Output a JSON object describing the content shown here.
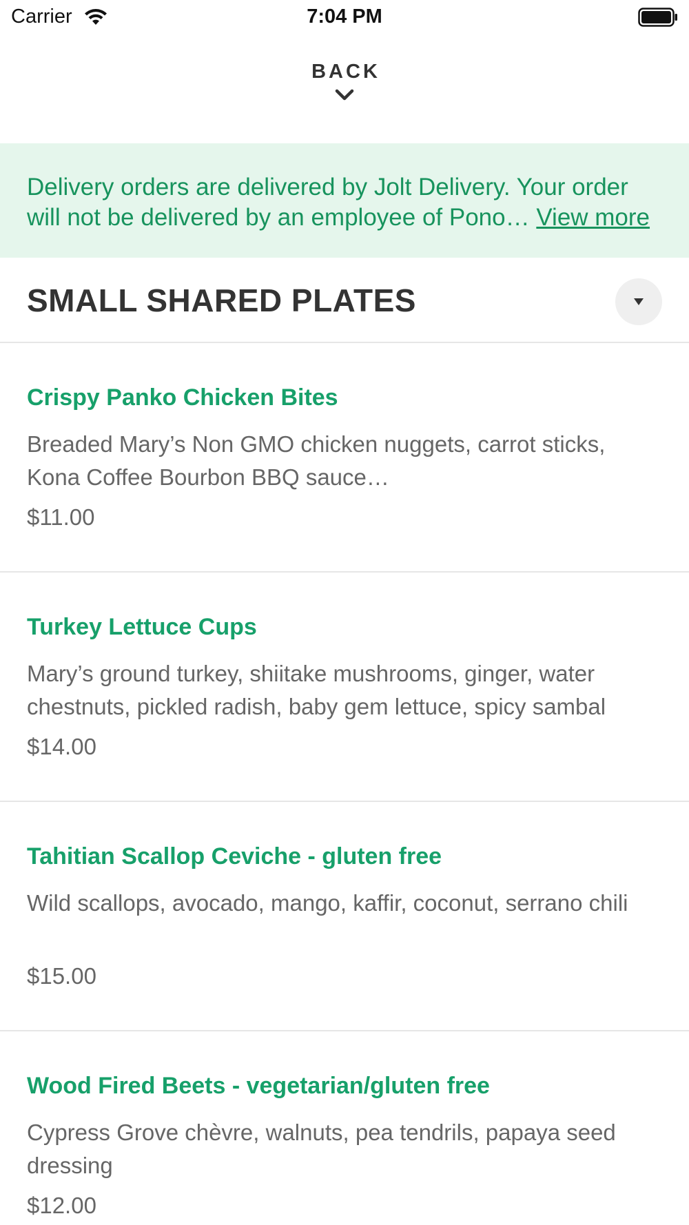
{
  "status_bar": {
    "carrier": "Carrier",
    "time": "7:04 PM",
    "wifi_icon": "wifi-icon",
    "battery_icon": "battery-icon"
  },
  "header": {
    "back_label": "BACK",
    "back_icon": "chevron-down-icon"
  },
  "banner": {
    "text": "Delivery orders are delivered by Jolt Delivery. Your order will not be delivered by an employee of Pono… ",
    "link_label": "View more",
    "background_color": "#e5f6ec",
    "text_color": "#17935d"
  },
  "section": {
    "title": "SMALL SHARED PLATES",
    "toggle_icon": "caret-down-icon"
  },
  "accent_color": "#17a06a",
  "items": [
    {
      "name": "Crispy Panko Chicken Bites",
      "description": "Breaded Mary’s Non GMO chicken nuggets, carrot sticks, Kona Coffee Bourbon BBQ sauce…",
      "price": "$11.00"
    },
    {
      "name": "Turkey Lettuce Cups",
      "description": "Mary’s ground turkey, shiitake mushrooms, ginger, water chestnuts, pickled radish, baby gem lettuce, spicy sambal",
      "price": "$14.00"
    },
    {
      "name": "Tahitian Scallop Ceviche - gluten free",
      "description": "Wild scallops, avocado, mango, kaffir, coconut, serrano chili",
      "price": "$15.00"
    },
    {
      "name": "Wood Fired Beets - vegetarian/gluten free",
      "description": "Cypress Grove chèvre, walnuts, pea tendrils, papaya seed dressing",
      "price": "$12.00"
    }
  ]
}
